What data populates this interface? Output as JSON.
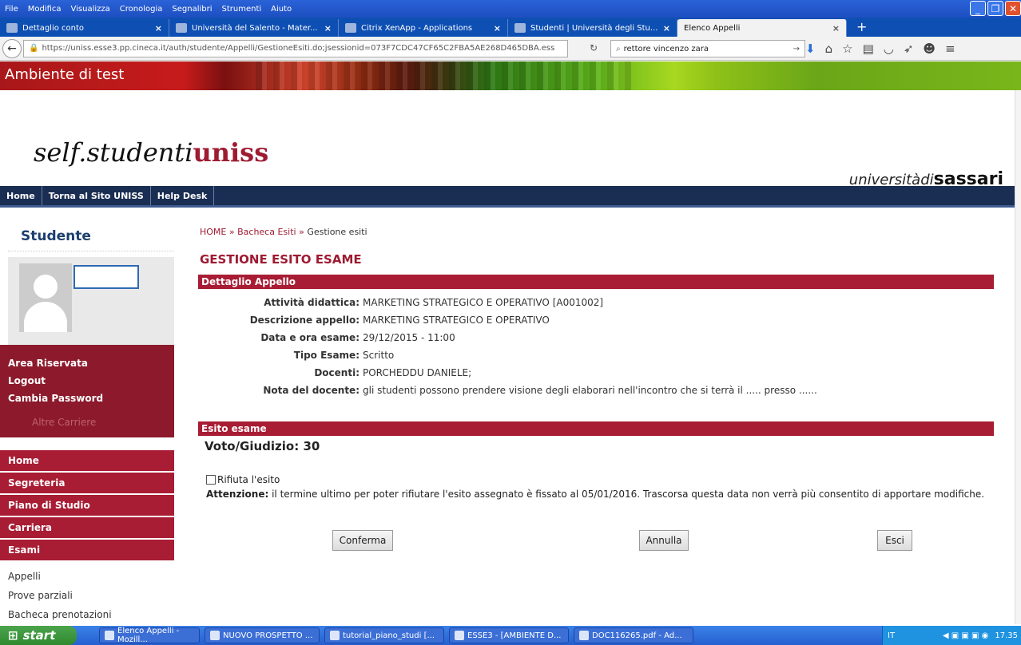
{
  "browser": {
    "menu": [
      "File",
      "Modifica",
      "Visualizza",
      "Cronologia",
      "Segnalibri",
      "Strumenti",
      "Aiuto"
    ],
    "tabs": [
      {
        "label": "Dettaglio conto"
      },
      {
        "label": "Università del Salento - Mater..."
      },
      {
        "label": "Citrix XenApp - Applications"
      },
      {
        "label": "Studenti | Università degli Stu..."
      },
      {
        "label": "Elenco Appelli",
        "active": true
      }
    ],
    "close_glyph": "×",
    "new_tab_glyph": "+",
    "url": "https://uniss.esse3.pp.cineca.it/auth/studente/Appelli/GestioneEsiti.do;jsessionid=073F7CDC47CF65C2FBA5AE268D465DBA.ess",
    "search_value": "rettore vincenzo zara"
  },
  "banner": {
    "text": "Ambiente di test"
  },
  "header": {
    "logo_prefix": "self.studenti",
    "logo_bold": "uniss",
    "uni_prefix": "universitàdi",
    "uni_bold": "sassari"
  },
  "nav": [
    "Home",
    "Torna al Sito UNISS",
    "Help Desk"
  ],
  "sidebar": {
    "title": "Studente",
    "area": [
      "Area Riservata",
      "Logout",
      "Cambia Password"
    ],
    "altre": "Altre Carriere",
    "menu": [
      "Home",
      "Segreteria",
      "Piano di Studio",
      "Carriera",
      "Esami"
    ],
    "submenu": [
      "Appelli",
      "Prove parziali",
      "Bacheca prenotazioni"
    ]
  },
  "main": {
    "breadcrumb": {
      "home": "HOME",
      "sep": "»",
      "bacheca": "Bacheca Esiti",
      "current": "Gestione esiti"
    },
    "title": "GESTIONE ESITO ESAME",
    "section1": "Dettaglio Appello",
    "details": [
      {
        "label": "Attività didattica:",
        "value": "MARKETING STRATEGICO E OPERATIVO [A001002]"
      },
      {
        "label": "Descrizione appello:",
        "value": "MARKETING STRATEGICO E OPERATIVO"
      },
      {
        "label": "Data e ora esame:",
        "value": "29/12/2015 - 11:00"
      },
      {
        "label": "Tipo Esame:",
        "value": "Scritto"
      },
      {
        "label": "Docenti:",
        "value": "PORCHEDDU DANIELE;"
      },
      {
        "label": "Nota del docente:",
        "value": "gli studenti possono prendere visione degli elaborari nell'incontro che si terrà il ..... presso ......"
      }
    ],
    "section2": "Esito esame",
    "voto": "Voto/Giudizio: 30",
    "rifiuta": "Rifiuta l'esito",
    "attenzione_label": "Attenzione:",
    "attenzione_text": "il termine ultimo per poter rifiutare l'esito assegnato è fissato al 05/01/2016. Trascorsa questa data non verrà più consentito di apportare modifiche.",
    "buttons": {
      "conferma": "Conferma",
      "annulla": "Annulla",
      "esci": "Esci"
    }
  },
  "taskbar": {
    "start": "start",
    "tasks": [
      "Elenco Appelli - Mozill...",
      "NUOVO PROSPETTO ...",
      "tutorial_piano_studi [...",
      "ESSE3 - [AMBIENTE D...",
      "DOC116265.pdf - Ad..."
    ],
    "lang": "IT",
    "clock": "17.35"
  }
}
